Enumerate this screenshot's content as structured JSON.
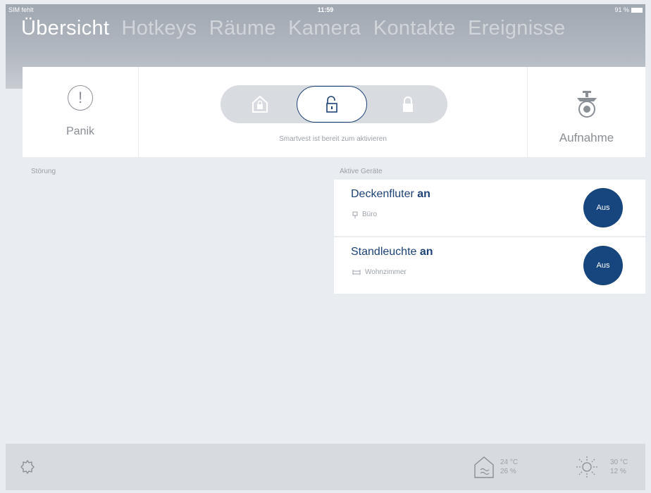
{
  "status": {
    "carrier": "SIM fehlt",
    "time": "11:59",
    "battery": "91 %"
  },
  "tabs": [
    "Übersicht",
    "Hotkeys",
    "Räume",
    "Kamera",
    "Kontakte",
    "Ereignisse"
  ],
  "controls": {
    "panik_label": "Panik",
    "mode_caption": "Smartvest ist bereit zum aktivieren",
    "aufnahme_label": "Aufnahme"
  },
  "sections": {
    "stoerung": "Störung",
    "aktive": "Aktive Geräte"
  },
  "devices": [
    {
      "name": "Deckenfluter",
      "state": "an",
      "room": "Büro",
      "button": "Aus"
    },
    {
      "name": "Standleuchte",
      "state": "an",
      "room": "Wohnzimmer",
      "button": "Aus"
    }
  ],
  "footer": {
    "inside_temp": "24 °C",
    "inside_humidity": "26 %",
    "outside_temp": "30 °C",
    "outside_humidity": "12 %"
  },
  "colors": {
    "accent": "#1d4276",
    "button": "#17467f",
    "header": "#9fa7b0"
  }
}
